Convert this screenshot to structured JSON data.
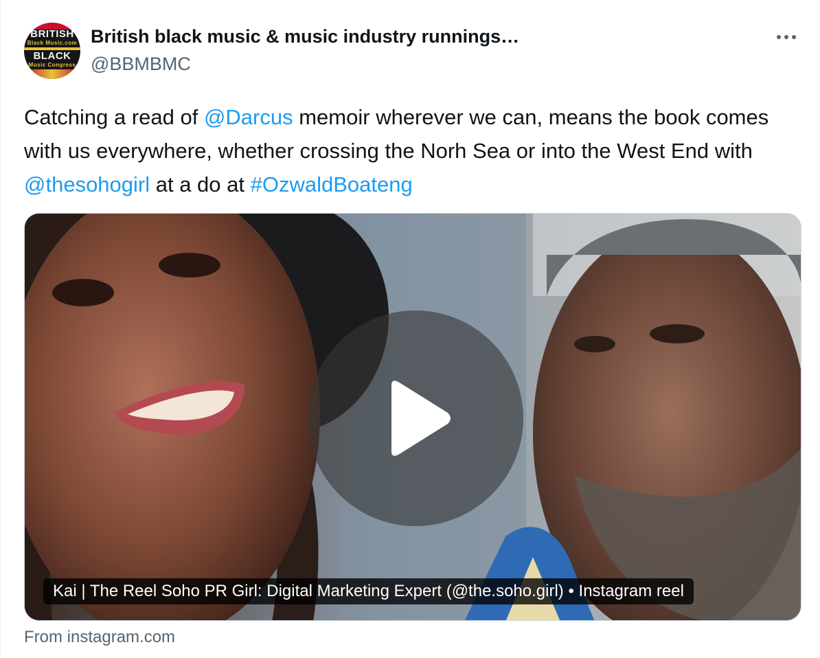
{
  "author": {
    "display_name": "British black music & music industry runnings…",
    "handle": "@BBMBMC",
    "avatar_text": {
      "line1": "BRITISH",
      "line2": "Black Music.com",
      "line3": "BLACK",
      "line4": "Music Congress"
    }
  },
  "tweet": {
    "segments": [
      {
        "text": "Catching a read of ",
        "type": "text"
      },
      {
        "text": "@Darcus",
        "type": "mention"
      },
      {
        "text": " memoir wherever we can, means the book comes with us everywhere, whether crossing the Norh Sea or into the West End with ",
        "type": "text"
      },
      {
        "text": "@thesohogirl",
        "type": "mention"
      },
      {
        "text": " at a do at ",
        "type": "text"
      },
      {
        "text": "#OzwaldBoateng",
        "type": "hashtag"
      }
    ]
  },
  "media": {
    "caption": "Kai | The Reel Soho PR Girl: Digital Marketing Expert (@the.soho.girl) • Instagram reel",
    "source": "From instagram.com",
    "play_icon": "play-icon"
  },
  "colors": {
    "link": "#1d9bf0",
    "muted": "#536471",
    "text": "#0f1419",
    "border": "#cfd9de"
  },
  "icons": {
    "more": "more-horizontal-icon"
  }
}
